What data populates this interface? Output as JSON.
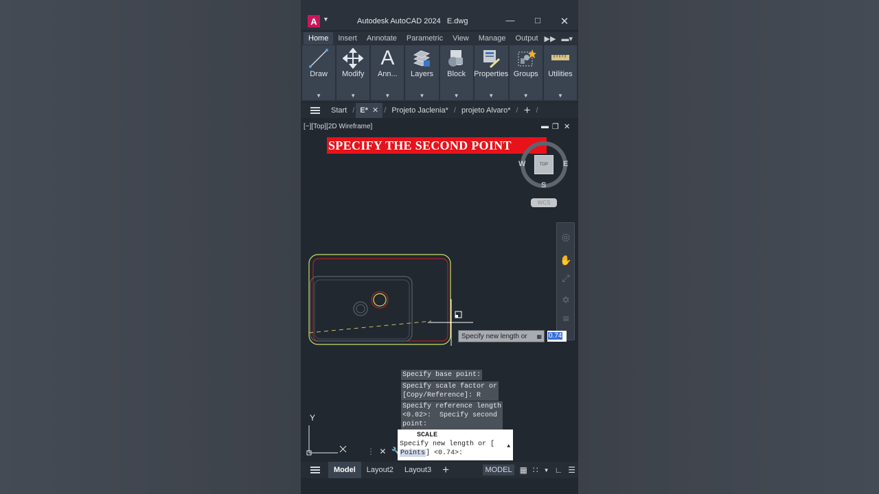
{
  "window": {
    "title": "Autodesk AutoCAD 2024",
    "file": "E.dwg",
    "logo": "A"
  },
  "ribbon_tabs": [
    "Home",
    "Insert",
    "Annotate",
    "Parametric",
    "View",
    "Manage",
    "Output"
  ],
  "ribbon_panels": [
    "Draw",
    "Modify",
    "Ann...",
    "Layers",
    "Block",
    "Properties",
    "Groups",
    "Utilities"
  ],
  "file_tabs": {
    "start": "Start",
    "active": "E*",
    "tab2": "Projeto Jaclenia*",
    "tab3": "projeto Alvaro*"
  },
  "viewport": {
    "label": "[−][Top][2D Wireframe]",
    "banner": "SPECIFY THE SECOND POINT",
    "compass": {
      "w": "W",
      "e": "E",
      "s": "S",
      "top": "TOP"
    },
    "wcs": "WCS",
    "ucs_y": "Y"
  },
  "dynamic_input": {
    "prompt": "Specify new length or",
    "value": "0.74"
  },
  "command_history": {
    "line1": "Specify base point:",
    "line2a": "Specify scale factor or",
    "line2b": "[Copy/Reference]: R",
    "line3a": "Specify reference length",
    "line3b": "<0.02>:  Specify second",
    "line3c": "point:"
  },
  "command_line": {
    "name": "SCALE",
    "prompt_a": "Specify new length or [",
    "option": "Points",
    "prompt_b": "] <0.74>:"
  },
  "status_bar": {
    "model_tab": "Model",
    "layout2": "Layout2",
    "layout3": "Layout3",
    "model_button": "MODEL"
  },
  "colors": {
    "banner_red": "#e8121a",
    "drawing_green": "#c8e06a",
    "drawing_red": "#d02020",
    "logo_pink": "#c8185c"
  }
}
